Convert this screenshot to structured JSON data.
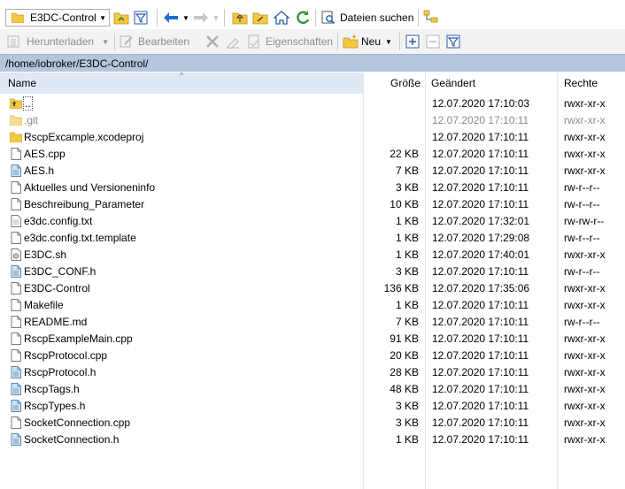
{
  "toolbar1": {
    "location": "E3DC-Control",
    "find_files_label": "Dateien suchen"
  },
  "toolbar2": {
    "download_label": "Herunterladen",
    "edit_label": "Bearbeiten",
    "properties_label": "Eigenschaften",
    "new_label": "Neu"
  },
  "path": "/home/iobroker/E3DC-Control/",
  "columns": {
    "name": "Name",
    "size": "Größe",
    "modified": "Geändert",
    "rights": "Rechte"
  },
  "files": [
    {
      "name": "..",
      "size": "",
      "modified": "12.07.2020 17:10:03",
      "rights": "rwxr-xr-x",
      "type": "parent"
    },
    {
      "name": ".git",
      "size": "",
      "modified": "12.07.2020 17:10:11",
      "rights": "rwxr-xr-x",
      "type": "folder-hidden"
    },
    {
      "name": "RscpExcample.xcodeproj",
      "size": "",
      "modified": "12.07.2020 17:10:11",
      "rights": "rwxr-xr-x",
      "type": "folder"
    },
    {
      "name": "AES.cpp",
      "size": "22 KB",
      "modified": "12.07.2020 17:10:11",
      "rights": "rwxr-xr-x",
      "type": "file"
    },
    {
      "name": "AES.h",
      "size": "7 KB",
      "modified": "12.07.2020 17:10:11",
      "rights": "rwxr-xr-x",
      "type": "header"
    },
    {
      "name": "Aktuelles und Versioneninfo",
      "size": "3 KB",
      "modified": "12.07.2020 17:10:11",
      "rights": "rw-r--r--",
      "type": "file"
    },
    {
      "name": "Beschreibung_Parameter",
      "size": "10 KB",
      "modified": "12.07.2020 17:10:11",
      "rights": "rw-r--r--",
      "type": "file"
    },
    {
      "name": "e3dc.config.txt",
      "size": "1 KB",
      "modified": "12.07.2020 17:32:01",
      "rights": "rw-rw-r--",
      "type": "text"
    },
    {
      "name": "e3dc.config.txt.template",
      "size": "1 KB",
      "modified": "12.07.2020 17:29:08",
      "rights": "rw-r--r--",
      "type": "file"
    },
    {
      "name": "E3DC.sh",
      "size": "1 KB",
      "modified": "12.07.2020 17:40:01",
      "rights": "rwxr-xr-x",
      "type": "script"
    },
    {
      "name": "E3DC_CONF.h",
      "size": "3 KB",
      "modified": "12.07.2020 17:10:11",
      "rights": "rw-r--r--",
      "type": "header"
    },
    {
      "name": "E3DC-Control",
      "size": "136 KB",
      "modified": "12.07.2020 17:35:06",
      "rights": "rwxr-xr-x",
      "type": "file"
    },
    {
      "name": "Makefile",
      "size": "1 KB",
      "modified": "12.07.2020 17:10:11",
      "rights": "rwxr-xr-x",
      "type": "file"
    },
    {
      "name": "README.md",
      "size": "7 KB",
      "modified": "12.07.2020 17:10:11",
      "rights": "rw-r--r--",
      "type": "file"
    },
    {
      "name": "RscpExampleMain.cpp",
      "size": "91 KB",
      "modified": "12.07.2020 17:10:11",
      "rights": "rwxr-xr-x",
      "type": "file"
    },
    {
      "name": "RscpProtocol.cpp",
      "size": "20 KB",
      "modified": "12.07.2020 17:10:11",
      "rights": "rwxr-xr-x",
      "type": "file"
    },
    {
      "name": "RscpProtocol.h",
      "size": "28 KB",
      "modified": "12.07.2020 17:10:11",
      "rights": "rwxr-xr-x",
      "type": "header"
    },
    {
      "name": "RscpTags.h",
      "size": "48 KB",
      "modified": "12.07.2020 17:10:11",
      "rights": "rwxr-xr-x",
      "type": "header"
    },
    {
      "name": "RscpTypes.h",
      "size": "3 KB",
      "modified": "12.07.2020 17:10:11",
      "rights": "rwxr-xr-x",
      "type": "header"
    },
    {
      "name": "SocketConnection.cpp",
      "size": "3 KB",
      "modified": "12.07.2020 17:10:11",
      "rights": "rwxr-xr-x",
      "type": "file"
    },
    {
      "name": "SocketConnection.h",
      "size": "1 KB",
      "modified": "12.07.2020 17:10:11",
      "rights": "rwxr-xr-x",
      "type": "header"
    }
  ],
  "colors": {
    "path_bar": "#b3c6dc",
    "folder": "#f5c842",
    "header_sel": "#dfe9f5"
  }
}
